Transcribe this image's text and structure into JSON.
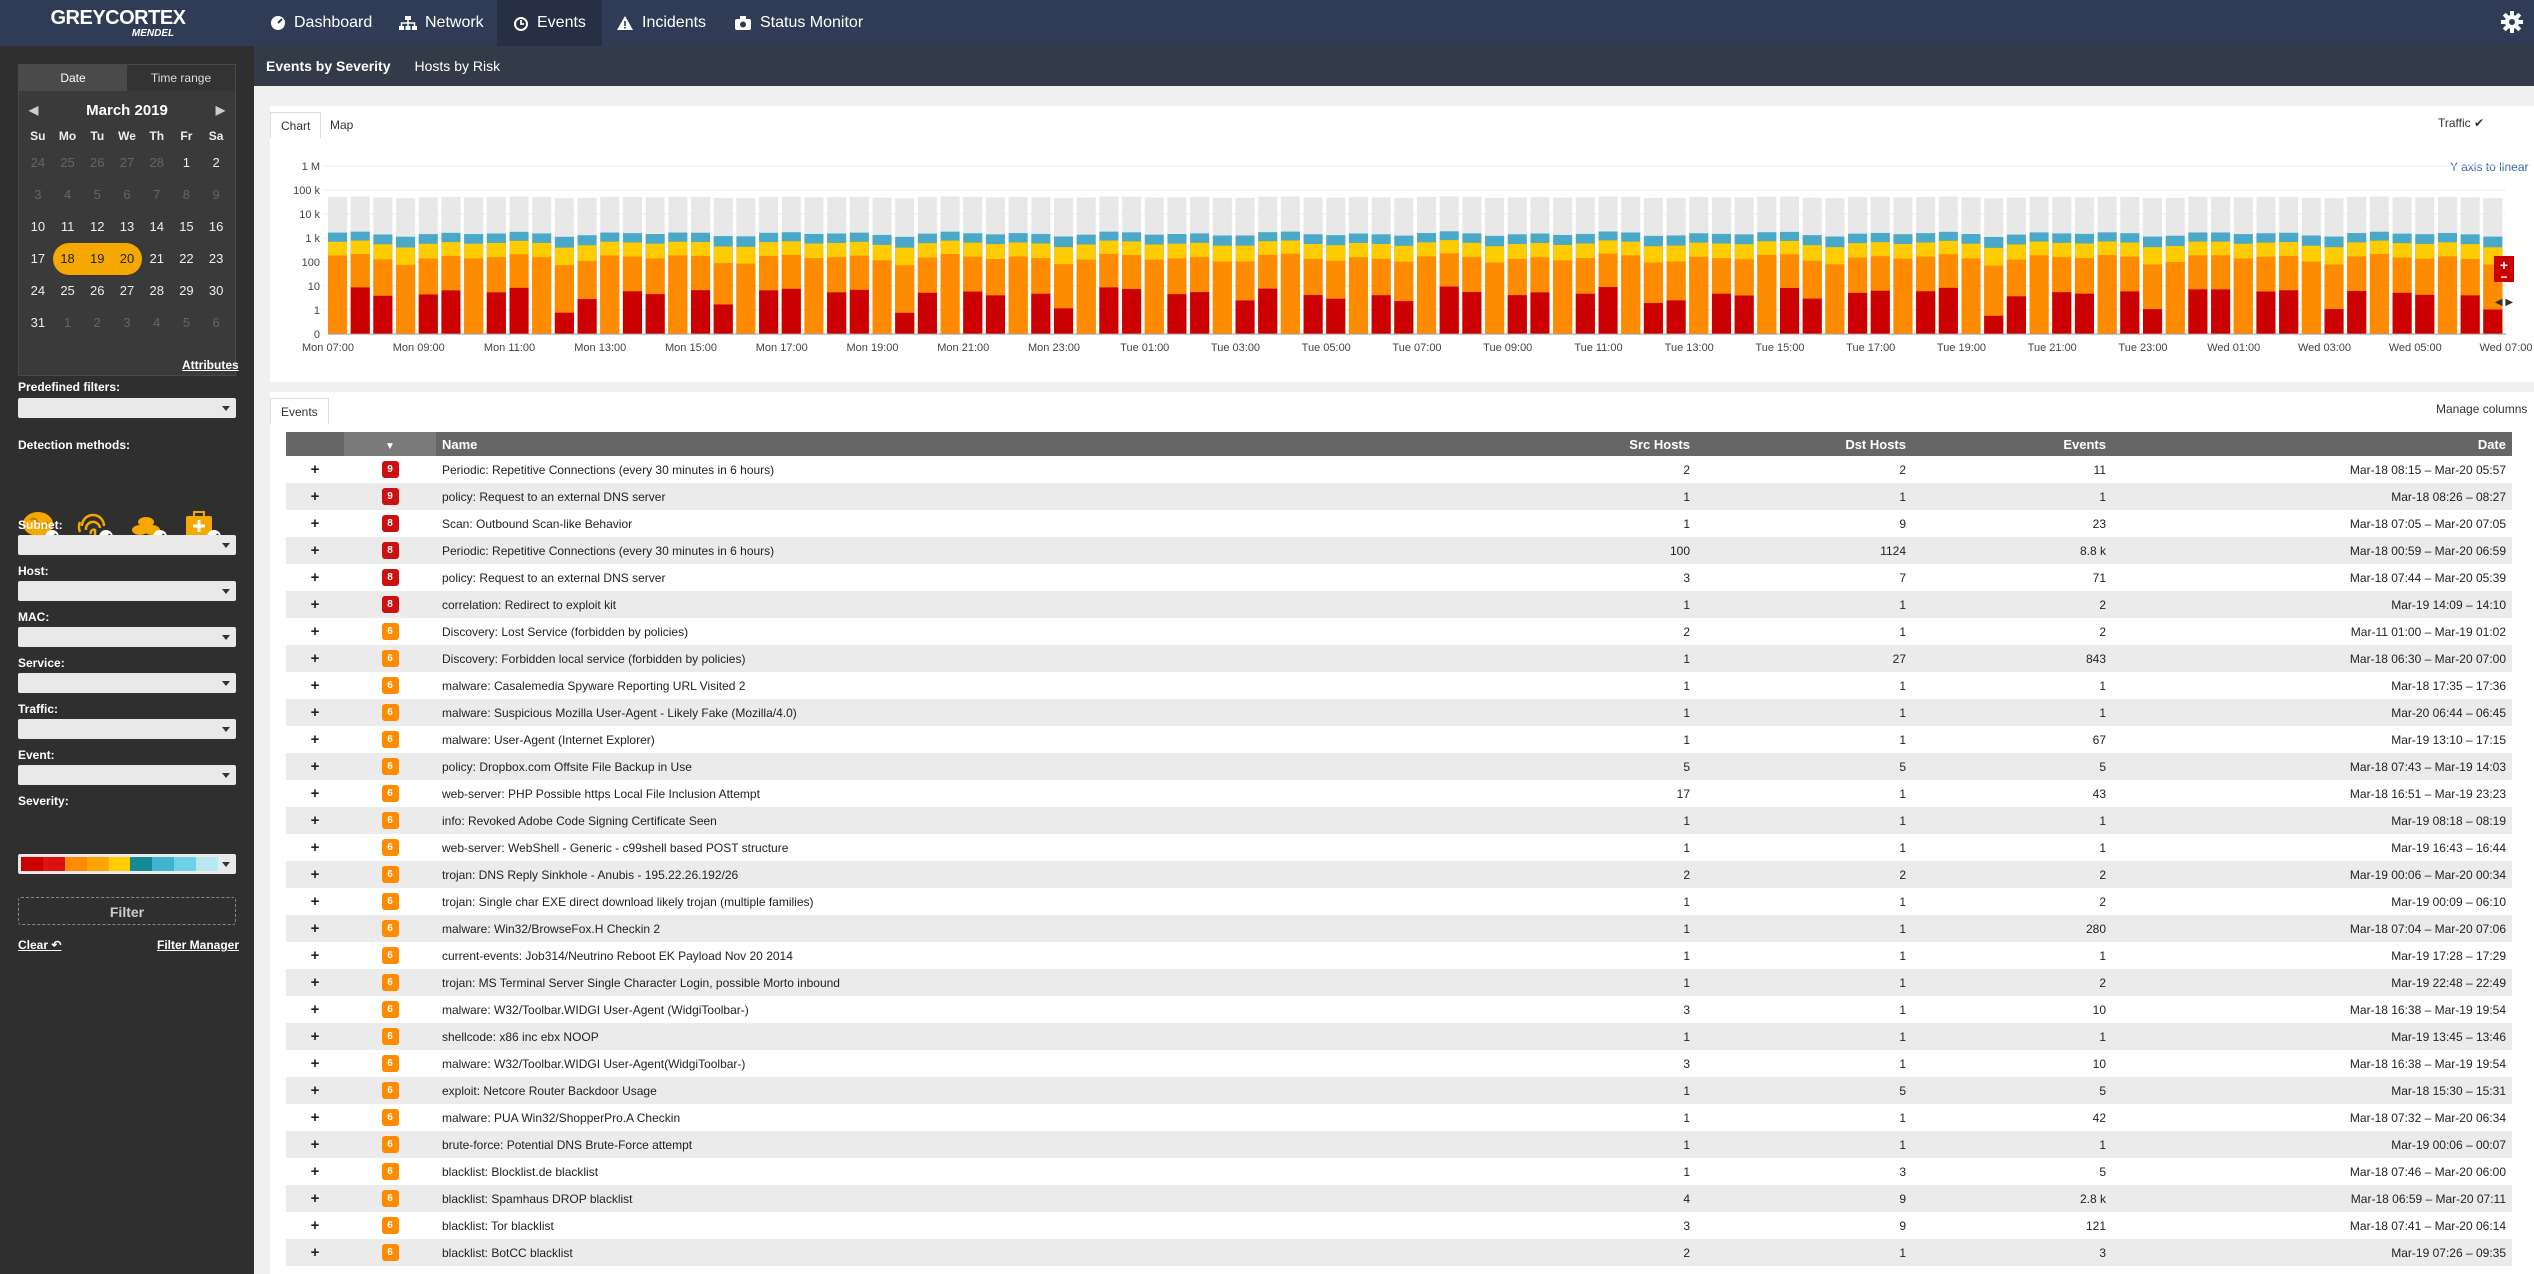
{
  "brand": {
    "line1": "GREYCORTEX",
    "line2": "MENDEL"
  },
  "nav": [
    {
      "label": "Dashboard",
      "icon": "gauge-icon"
    },
    {
      "label": "Network",
      "icon": "network-icon"
    },
    {
      "label": "Events",
      "icon": "alarm-icon",
      "active": true
    },
    {
      "label": "Incidents",
      "icon": "warning-icon"
    },
    {
      "label": "Status Monitor",
      "icon": "camera-icon"
    }
  ],
  "sidebar": {
    "tabs": [
      "Date",
      "Time range"
    ],
    "month": "March 2019",
    "dow": [
      "Su",
      "Mo",
      "Tu",
      "We",
      "Th",
      "Fr",
      "Sa"
    ],
    "days": [
      [
        "24",
        "25",
        "26",
        "27",
        "28",
        "1",
        "2"
      ],
      [
        "3",
        "4",
        "5",
        "6",
        "7",
        "8",
        "9"
      ],
      [
        "10",
        "11",
        "12",
        "13",
        "14",
        "15",
        "16"
      ],
      [
        "17",
        "18",
        "19",
        "20",
        "21",
        "22",
        "23"
      ],
      [
        "24",
        "25",
        "26",
        "27",
        "28",
        "29",
        "30"
      ],
      [
        "31",
        "1",
        "2",
        "3",
        "4",
        "5",
        "6"
      ]
    ],
    "attributes_link": "Attributes",
    "predefined_label": "Predefined filters:",
    "detection_label": "Detection methods:",
    "fields": [
      "Subnet:",
      "Host:",
      "MAC:",
      "Service:",
      "Traffic:",
      "Event:"
    ],
    "severity_label": "Severity:",
    "severity_colors": [
      "#cc0000",
      "#e01010",
      "#ff8c00",
      "#ffa500",
      "#ffcc00",
      "#138a96",
      "#3fb4cc",
      "#6fd0e4",
      "#b8e8f2"
    ],
    "filter_button": "Filter",
    "clear_link": "Clear",
    "filter_manager_link": "Filter Manager"
  },
  "subnav": {
    "tabs": [
      "Events by Severity",
      "Hosts by Risk"
    ]
  },
  "chart_panel": {
    "tabs": [
      "Chart",
      "Map"
    ],
    "traffic_label": "Traffic",
    "y_axis_link": "Y axis to linear"
  },
  "chart_data": {
    "type": "bar",
    "stacked": true,
    "yscale": "log",
    "yticks": [
      "1 M",
      "100 k",
      "10 k",
      "1 k",
      "100",
      "10",
      "1",
      "0"
    ],
    "xticks": [
      "Mon 07:00",
      "Mon 09:00",
      "Mon 11:00",
      "Mon 13:00",
      "Mon 15:00",
      "Mon 17:00",
      "Mon 19:00",
      "Mon 21:00",
      "Mon 23:00",
      "Tue 01:00",
      "Tue 03:00",
      "Tue 05:00",
      "Tue 07:00",
      "Tue 09:00",
      "Tue 11:00",
      "Tue 13:00",
      "Tue 15:00",
      "Tue 17:00",
      "Tue 19:00",
      "Tue 21:00",
      "Tue 23:00",
      "Wed 01:00",
      "Wed 03:00",
      "Wed 05:00",
      "Wed 07:00"
    ],
    "bar_count": 96,
    "series": [
      {
        "color": "#e8e8e8",
        "approx_total": 50000
      },
      {
        "color": "#4aa8c8",
        "approx_total": 1500
      },
      {
        "color": "#ffcc00",
        "approx_total": 600
      },
      {
        "color": "#ff8c00",
        "approx_total": 150
      },
      {
        "color": "#cc0000",
        "approx_total": 5
      }
    ]
  },
  "events_panel": {
    "tab": "Events",
    "manage_columns": "Manage columns"
  },
  "table": {
    "headers": [
      "",
      "",
      "Name",
      "Src Hosts",
      "Dst Hosts",
      "Events",
      "Date"
    ],
    "rows": [
      {
        "sev": "9",
        "name": "Periodic: Repetitive Connections (every 30 minutes in 6 hours)",
        "src": "2",
        "dst": "2",
        "events": "11",
        "date": "Mar-18 08:15 – Mar-20 05:57"
      },
      {
        "sev": "9",
        "name": "policy: Request to an external DNS server",
        "src": "1",
        "dst": "1",
        "events": "1",
        "date": "Mar-18 08:26 – 08:27"
      },
      {
        "sev": "8",
        "name": "Scan: Outbound Scan-like Behavior",
        "src": "1",
        "dst": "9",
        "events": "23",
        "date": "Mar-18 07:05 – Mar-20 07:05"
      },
      {
        "sev": "8",
        "name": "Periodic: Repetitive Connections (every 30 minutes in 6 hours)",
        "src": "100",
        "dst": "1124",
        "events": "8.8 k",
        "date": "Mar-18 00:59 – Mar-20 06:59"
      },
      {
        "sev": "8",
        "name": "policy: Request to an external DNS server",
        "src": "3",
        "dst": "7",
        "events": "71",
        "date": "Mar-18 07:44 – Mar-20 05:39"
      },
      {
        "sev": "8",
        "name": "correlation: Redirect to exploit kit",
        "src": "1",
        "dst": "1",
        "events": "2",
        "date": "Mar-19 14:09 – 14:10"
      },
      {
        "sev": "6",
        "name": "Discovery: Lost Service (forbidden by policies)",
        "src": "2",
        "dst": "1",
        "events": "2",
        "date": "Mar-11 01:00 – Mar-19 01:02"
      },
      {
        "sev": "6",
        "name": "Discovery: Forbidden local service (forbidden by policies)",
        "src": "1",
        "dst": "27",
        "events": "843",
        "date": "Mar-18 06:30 – Mar-20 07:00"
      },
      {
        "sev": "6",
        "name": "malware: Casalemedia Spyware Reporting URL Visited 2",
        "src": "1",
        "dst": "1",
        "events": "1",
        "date": "Mar-18 17:35 – 17:36"
      },
      {
        "sev": "6",
        "name": "malware: Suspicious Mozilla User-Agent - Likely Fake (Mozilla/4.0)",
        "src": "1",
        "dst": "1",
        "events": "1",
        "date": "Mar-20 06:44 – 06:45"
      },
      {
        "sev": "6",
        "name": "malware: User-Agent (Internet Explorer)",
        "src": "1",
        "dst": "1",
        "events": "67",
        "date": "Mar-19 13:10 – 17:15"
      },
      {
        "sev": "6",
        "name": "policy: Dropbox.com Offsite File Backup in Use",
        "src": "5",
        "dst": "5",
        "events": "5",
        "date": "Mar-18 07:43 – Mar-19 14:03"
      },
      {
        "sev": "6",
        "name": "web-server: PHP Possible https Local File Inclusion Attempt",
        "src": "17",
        "dst": "1",
        "events": "43",
        "date": "Mar-18 16:51 – Mar-19 23:23"
      },
      {
        "sev": "6",
        "name": "info: Revoked Adobe Code Signing Certificate Seen",
        "src": "1",
        "dst": "1",
        "events": "1",
        "date": "Mar-19 08:18 – 08:19"
      },
      {
        "sev": "6",
        "name": "web-server: WebShell - Generic - c99shell based POST structure",
        "src": "1",
        "dst": "1",
        "events": "1",
        "date": "Mar-19 16:43 – 16:44"
      },
      {
        "sev": "6",
        "name": "trojan: DNS Reply Sinkhole - Anubis - 195.22.26.192/26",
        "src": "2",
        "dst": "2",
        "events": "2",
        "date": "Mar-19 00:06 – Mar-20 00:34"
      },
      {
        "sev": "6",
        "name": "trojan: Single char EXE direct download likely trojan (multiple families)",
        "src": "1",
        "dst": "1",
        "events": "2",
        "date": "Mar-19 00:09 – 06:10"
      },
      {
        "sev": "6",
        "name": "malware: Win32/BrowseFox.H Checkin 2",
        "src": "1",
        "dst": "1",
        "events": "280",
        "date": "Mar-18 07:04 – Mar-20 07:06"
      },
      {
        "sev": "6",
        "name": "current-events: Job314/Neutrino Reboot EK Payload Nov 20 2014",
        "src": "1",
        "dst": "1",
        "events": "1",
        "date": "Mar-19 17:28 – 17:29"
      },
      {
        "sev": "6",
        "name": "trojan: MS Terminal Server Single Character Login, possible Morto inbound",
        "src": "1",
        "dst": "1",
        "events": "2",
        "date": "Mar-19 22:48 – 22:49"
      },
      {
        "sev": "6",
        "name": "malware: W32/Toolbar.WIDGI User-Agent (WidgiToolbar-)",
        "src": "3",
        "dst": "1",
        "events": "10",
        "date": "Mar-18 16:38 – Mar-19 19:54"
      },
      {
        "sev": "6",
        "name": "shellcode: x86 inc ebx NOOP",
        "src": "1",
        "dst": "1",
        "events": "1",
        "date": "Mar-19 13:45 – 13:46"
      },
      {
        "sev": "6",
        "name": "malware: W32/Toolbar.WIDGI User-Agent(WidgiToolbar-)",
        "src": "3",
        "dst": "1",
        "events": "10",
        "date": "Mar-18 16:38 – Mar-19 19:54"
      },
      {
        "sev": "6",
        "name": "exploit: Netcore Router Backdoor Usage",
        "src": "1",
        "dst": "5",
        "events": "5",
        "date": "Mar-18 15:30 – 15:31"
      },
      {
        "sev": "6",
        "name": "malware: PUA Win32/ShopperPro.A Checkin",
        "src": "1",
        "dst": "1",
        "events": "42",
        "date": "Mar-18 07:32 – Mar-20 06:34"
      },
      {
        "sev": "6",
        "name": "brute-force: Potential DNS Brute-Force attempt",
        "src": "1",
        "dst": "1",
        "events": "1",
        "date": "Mar-19 00:06 – 00:07"
      },
      {
        "sev": "6",
        "name": "blacklist: Blocklist.de blacklist",
        "src": "1",
        "dst": "3",
        "events": "5",
        "date": "Mar-18 07:46 – Mar-20 06:00"
      },
      {
        "sev": "6",
        "name": "blacklist: Spamhaus DROP blacklist",
        "src": "4",
        "dst": "9",
        "events": "2.8 k",
        "date": "Mar-18 06:59 – Mar-20 07:11"
      },
      {
        "sev": "6",
        "name": "blacklist: Tor blacklist",
        "src": "3",
        "dst": "9",
        "events": "121",
        "date": "Mar-18 07:41 – Mar-20 06:14"
      },
      {
        "sev": "6",
        "name": "blacklist: BotCC blacklist",
        "src": "2",
        "dst": "1",
        "events": "3",
        "date": "Mar-19 07:26 – 09:35"
      }
    ]
  },
  "colors": {
    "sev9": "#cc1111",
    "sev8": "#cc1111",
    "sev6": "#ff8c00",
    "accent": "#f5a800",
    "topbar": "#303c55"
  }
}
